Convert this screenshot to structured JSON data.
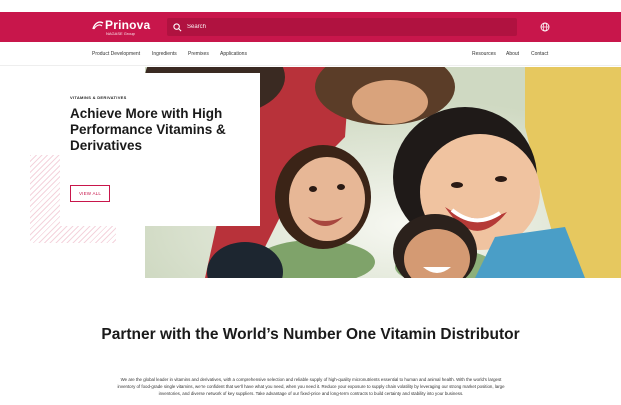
{
  "brand": {
    "name": "Prinova",
    "sub": "NAGASE Group"
  },
  "search": {
    "placeholder": "Search"
  },
  "nav": {
    "left": [
      "Product Development",
      "Ingredients",
      "Premixes",
      "Applications"
    ],
    "right": [
      "Resources",
      "About",
      "Contact"
    ]
  },
  "hero": {
    "eyebrow": "VITAMINS & DERIVATIVES",
    "title": "Achieve More with High Performance Vitamins & Derivatives",
    "cta": "VIEW ALL"
  },
  "section": {
    "title": "Partner with the World’s Number One Vitamin Distributor",
    "body": "We are the global leader in vitamins and derivatives, with a comprehensive selection and reliable supply of high-quality micronutrients essential to human and animal health. With the world’s largest inventory of food-grade single vitamins, we’re confident that we’ll have what you need, when you need it. Reduce your exposure to supply chain volatility by leveraging our strong market position, large inventories, and diverse network of key suppliers. Take advantage of our fixed-price and long-term contracts to build certainty and stability into your business."
  },
  "colors": {
    "brand": "#c8164b",
    "search_bg": "#b01240"
  },
  "icons": {
    "search": "search-icon",
    "globe": "globe-icon",
    "logo": "prinova-logo-mark"
  }
}
